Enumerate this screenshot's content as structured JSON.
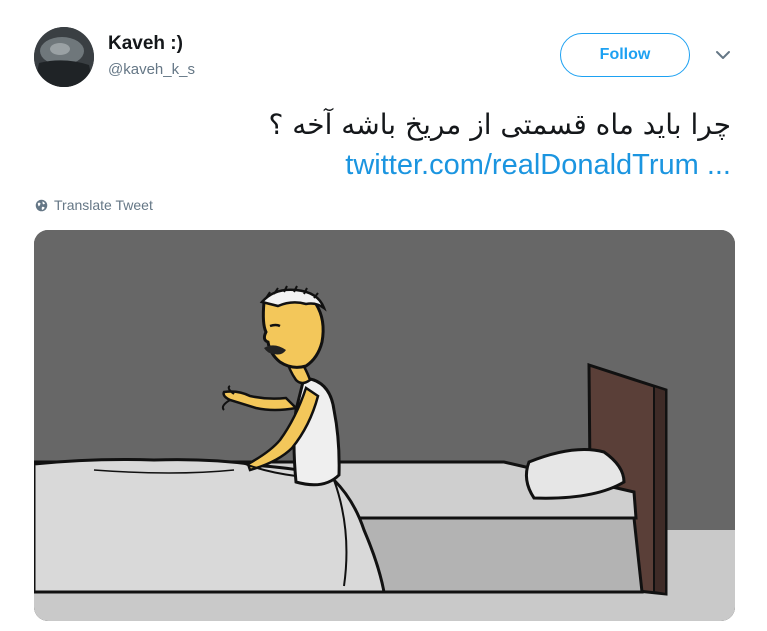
{
  "tweet": {
    "author": {
      "display_name": "Kaveh :)",
      "handle": "@kaveh_k_s",
      "avatar_icon": "avatar-photo"
    },
    "follow_label": "Follow",
    "menu_icon": "chevron-down-icon",
    "text": "چرا باید ماه قسمتی از مریخ باشه آخه ؟",
    "link_text": "twitter.com/realDonaldTrum ...",
    "translate_label": "Translate Tweet",
    "translate_icon": "globe-icon",
    "media": {
      "kind": "cartoon illustration"
    }
  },
  "colors": {
    "accent": "#1da1f2",
    "link": "#1b95e0",
    "muted": "#657786",
    "text": "#14171a",
    "wall": "#676767",
    "floor": "#c9c9c9",
    "headboard": "#5a3f38",
    "skin": "#f3c75a"
  }
}
